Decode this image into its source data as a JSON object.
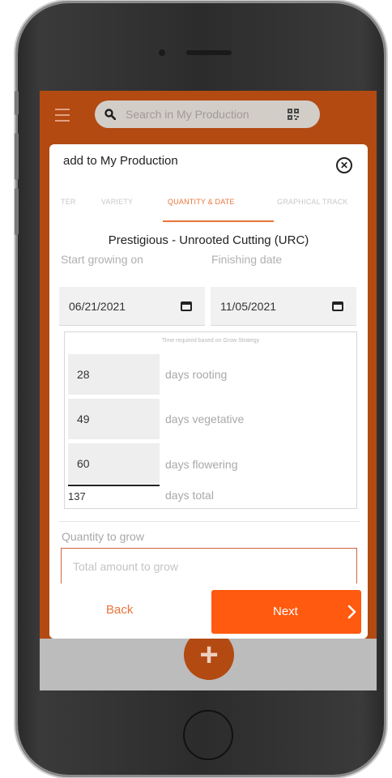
{
  "search": {
    "placeholder": "Search in My Production"
  },
  "modal": {
    "title": "add to My Production",
    "tabs": [
      "TER",
      "VARIETY",
      "QUANTITY & DATE",
      "GRAPHICAL TRACK"
    ],
    "active_tab_index": 2,
    "product_title": "Prestigious - Unrooted Cutting (URC)",
    "start_label": "Start growing on",
    "finish_label": "Finishing date",
    "start_date": "06/21/2021",
    "finish_date": "11/05/2021",
    "time_hint": "Time required based on Grow Strategy",
    "phases": [
      {
        "value": "28",
        "unit": "days rooting"
      },
      {
        "value": "49",
        "unit": "days vegetative"
      },
      {
        "value": "60",
        "unit": "days flowering"
      }
    ],
    "total": {
      "value": "137",
      "unit": "days total"
    },
    "quantity_label": "Quantity to grow",
    "quantity_placeholder": "Total amount to grow",
    "back_label": "Back",
    "next_label": "Next"
  },
  "colors": {
    "brand": "#b24a12",
    "accent": "#ff5a10",
    "tab_active": "#e8743a"
  },
  "icons": [
    "hamburger-menu-icon",
    "search-icon",
    "qr-code-icon",
    "close-icon",
    "calendar-icon",
    "chevron-right-icon",
    "plus-icon"
  ]
}
